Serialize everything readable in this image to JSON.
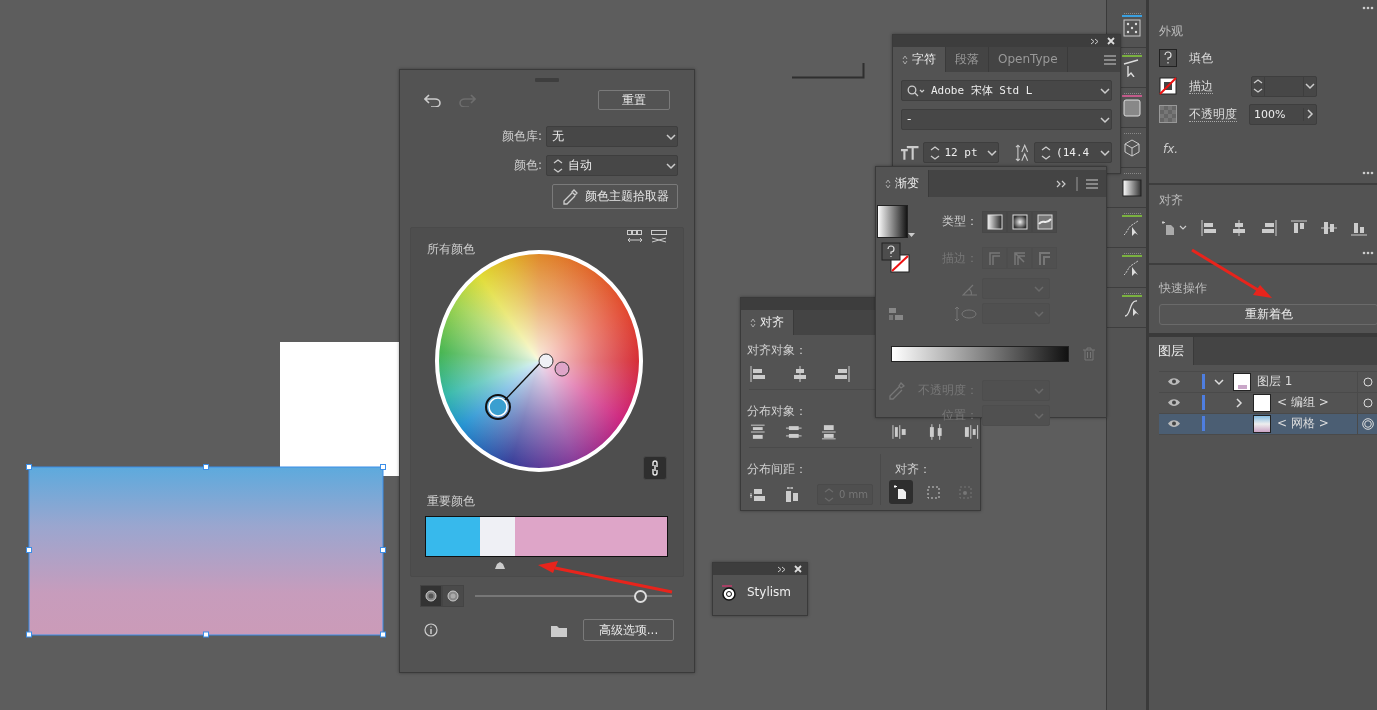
{
  "recolor": {
    "reset": "重置",
    "library_label": "颜色库:",
    "library_value": "无",
    "color_label": "颜色:",
    "color_value": "自动",
    "picker": "颜色主题拾取器",
    "all_colors": "所有颜色",
    "important_colors": "重要颜色",
    "swatches": [
      {
        "color": "#37b9ec"
      },
      {
        "color": "#eff0f5"
      },
      {
        "color": "#dea5c8"
      }
    ],
    "modes": [
      {
        "selected": true
      },
      {
        "selected": false
      }
    ],
    "saturation": {
      "level": 0.84
    },
    "advanced": "高级选项..."
  },
  "character": {
    "tabs": [
      {
        "label": "字符",
        "selected": true
      },
      {
        "label": "段落",
        "selected": false
      },
      {
        "label": "OpenType",
        "selected": false
      }
    ],
    "font": "Adobe 宋体 Std L",
    "style": "-",
    "size": "12 pt",
    "leading": "(14.4"
  },
  "gradient": {
    "title": "渐变",
    "type_label": "类型：",
    "stroke_label": "描边：",
    "opacity_label": "不透明度：",
    "position_label": "位置："
  },
  "align": {
    "tab": "对齐",
    "align_objects": "对齐对象：",
    "distribute_objects": "分布对象：",
    "distribute_spacing": "分布间距：",
    "align_to": "对齐：",
    "spacing": "0 mm",
    "align_to_options": [
      {
        "selected": true
      },
      {
        "selected": false
      },
      {
        "selected": false
      }
    ]
  },
  "stylism": {
    "title": "Stylism"
  },
  "properties": {
    "appearance": "外观",
    "fill": "填色",
    "stroke": "描边",
    "opacity": "不透明度",
    "opacity_value": "100%",
    "fx": "fx.",
    "align": "对齐",
    "quick_actions": "快速操作",
    "recolor": "重新着色"
  },
  "layers": {
    "tab": "图层",
    "items": [
      {
        "name": "图层 1",
        "expanded": true,
        "selected": false,
        "children": [
          {
            "name": "< 编组 >",
            "expanded": false,
            "selected": false
          },
          {
            "name": "< 网格 >",
            "selected": true
          }
        ]
      }
    ]
  }
}
